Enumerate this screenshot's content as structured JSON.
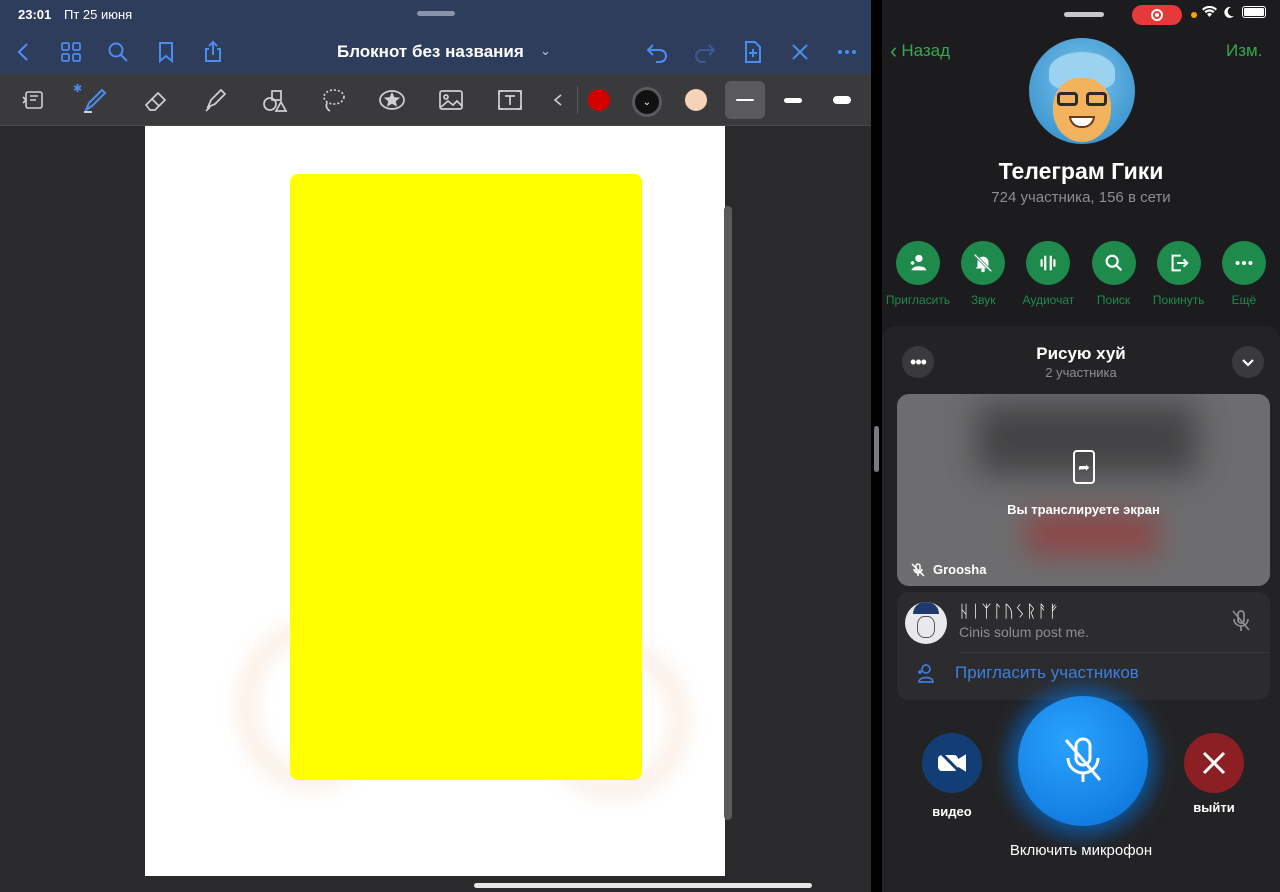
{
  "left_app": {
    "status": {
      "time": "23:01",
      "date": "Пт 25 июня"
    },
    "nav": {
      "title": "Блокнот без названия",
      "title_chevron": "⌄"
    },
    "toolbar": {
      "colors": [
        "#d40000",
        "#111111",
        "#f6d3b8"
      ],
      "accent": "#4a8df0"
    },
    "canvas": {
      "shape_color": "#ffff00"
    }
  },
  "right_app": {
    "nav": {
      "back": "Назад",
      "edit": "Изм."
    },
    "group": {
      "name": "Телеграм Гики",
      "subtitle": "724 участника, 156 в сети"
    },
    "actions": [
      {
        "label": "Пригласить",
        "icon": "add-user-icon"
      },
      {
        "label": "Звук",
        "icon": "mute-bell-icon"
      },
      {
        "label": "Аудиочат",
        "icon": "audio-wave-icon"
      },
      {
        "label": "Поиск",
        "icon": "search-icon"
      },
      {
        "label": "Покинуть",
        "icon": "leave-icon"
      },
      {
        "label": "Ещё",
        "icon": "more-icon"
      }
    ],
    "call": {
      "title": "Рисую хуй",
      "subtitle": "2 участника",
      "screen_share_text": "Вы транслируете экран",
      "sharing_user": "Groosha",
      "participant": {
        "name": "ᚺᛁᛉᛚᚢᛊᚱᚨᚠ",
        "status": "Cinis solum post me."
      },
      "invite": "Пригласить участников",
      "video_label": "видео",
      "mic_label": "Включить микрофон",
      "leave_label": "выйти"
    },
    "accent": "#1e8a4c"
  }
}
